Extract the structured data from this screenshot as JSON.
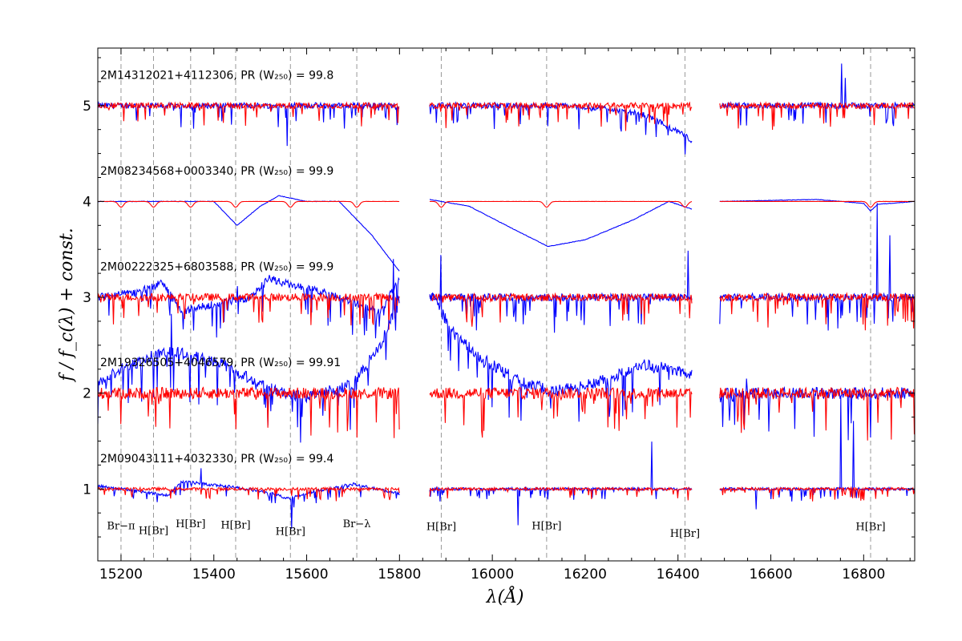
{
  "chart_data": {
    "type": "line",
    "xlabel": "λ(Å)",
    "ylabel": "f / f_c(λ) + const.",
    "xlim": [
      15150,
      16910
    ],
    "ylim": [
      0.25,
      5.6
    ],
    "x_ticks": [
      "15200",
      "15400",
      "15600",
      "15800",
      "16000",
      "16200",
      "16400",
      "16600",
      "16800"
    ],
    "y_ticks": [
      "1",
      "2",
      "3",
      "4",
      "5"
    ],
    "chips": [
      [
        15150,
        15800
      ],
      [
        15865,
        16430
      ],
      [
        16490,
        16910
      ]
    ],
    "grid": false,
    "legend": "none",
    "colors": {
      "observed": "#0000ff",
      "model": "#ff0000",
      "marker": "#999999"
    },
    "line_markers": [
      {
        "x": 15200,
        "label": "Br−π"
      },
      {
        "x": 15270,
        "label": "H[Br]"
      },
      {
        "x": 15350,
        "label": "H[Br]"
      },
      {
        "x": 15447,
        "label": "H[Br]"
      },
      {
        "x": 15565,
        "label": "H[Br]"
      },
      {
        "x": 15708,
        "label": "Br−λ"
      },
      {
        "x": 15890,
        "label": "H[Br]"
      },
      {
        "x": 16117,
        "label": "H[Br]"
      },
      {
        "x": 16415,
        "label": "H[Br]"
      },
      {
        "x": 16815,
        "label": "H[Br]"
      }
    ],
    "spectra": [
      {
        "label": "2M14312021+4112306, PR (W₂₅₀) = 99.8",
        "offset": 5.0,
        "continuum": [
          [
            15150,
            5.0
          ],
          [
            16150,
            5.0
          ],
          [
            16250,
            4.97
          ],
          [
            16330,
            4.9
          ],
          [
            16380,
            4.78
          ],
          [
            16430,
            4.64
          ],
          [
            16490,
            5.0
          ],
          [
            16910,
            5.0
          ]
        ],
        "observed_noise": 0.06,
        "model_noise": 0.06
      },
      {
        "label": "2M08234568+0003340, PR (W₂₅₀) = 99.9",
        "offset": 4.0,
        "continuum": [
          [
            15150,
            4.0
          ],
          [
            15400,
            4.0
          ],
          [
            15450,
            3.75
          ],
          [
            15500,
            3.95
          ],
          [
            15540,
            4.06
          ],
          [
            15600,
            4.0
          ],
          [
            15670,
            4.0
          ],
          [
            15740,
            3.65
          ],
          [
            15800,
            3.27
          ],
          [
            15865,
            4.02
          ],
          [
            15950,
            3.95
          ],
          [
            16050,
            3.7
          ],
          [
            16120,
            3.53
          ],
          [
            16200,
            3.6
          ],
          [
            16300,
            3.8
          ],
          [
            16380,
            4.0
          ],
          [
            16430,
            3.92
          ],
          [
            16490,
            4.0
          ],
          [
            16700,
            4.02
          ],
          [
            16800,
            3.98
          ],
          [
            16815,
            3.9
          ],
          [
            16830,
            3.97
          ],
          [
            16910,
            4.0
          ]
        ],
        "observed_noise": 0.005,
        "model_noise": 0.002
      },
      {
        "label": "2M00222325+6803588, PR (W₂₅₀) = 99.9",
        "offset": 3.0,
        "continuum": [
          [
            15150,
            3.0
          ],
          [
            15230,
            3.05
          ],
          [
            15290,
            3.15
          ],
          [
            15330,
            2.85
          ],
          [
            15420,
            2.95
          ],
          [
            15480,
            3.0
          ],
          [
            15520,
            3.2
          ],
          [
            15570,
            3.12
          ],
          [
            15640,
            3.05
          ],
          [
            15700,
            2.95
          ],
          [
            15760,
            2.85
          ],
          [
            15800,
            3.2
          ],
          [
            15865,
            3.0
          ],
          [
            16430,
            3.0
          ],
          [
            16490,
            3.0
          ],
          [
            16910,
            3.0
          ]
        ],
        "observed_noise": 0.08,
        "model_noise": 0.08
      },
      {
        "label": "2M19326505+4046579, PR (W₂₅₀) = 99.91",
        "offset": 2.0,
        "continuum": [
          [
            15150,
            2.1
          ],
          [
            15200,
            2.25
          ],
          [
            15300,
            2.45
          ],
          [
            15420,
            2.3
          ],
          [
            15520,
            2.05
          ],
          [
            15600,
            1.95
          ],
          [
            15700,
            2.1
          ],
          [
            15760,
            2.5
          ],
          [
            15800,
            3.0
          ],
          [
            15865,
            3.05
          ],
          [
            15920,
            2.6
          ],
          [
            15980,
            2.35
          ],
          [
            16050,
            2.15
          ],
          [
            16130,
            2.02
          ],
          [
            16220,
            2.1
          ],
          [
            16330,
            2.3
          ],
          [
            16430,
            2.2
          ],
          [
            16490,
            2.0
          ],
          [
            16910,
            2.0
          ]
        ],
        "observed_noise": 0.12,
        "model_noise": 0.12
      },
      {
        "label": "2M09043111+4032330, PR (W₂₅₀) = 99.4",
        "offset": 1.0,
        "continuum": [
          [
            15150,
            1.03
          ],
          [
            15250,
            0.97
          ],
          [
            15300,
            0.93
          ],
          [
            15330,
            1.08
          ],
          [
            15440,
            1.02
          ],
          [
            15520,
            0.96
          ],
          [
            15560,
            0.9
          ],
          [
            15620,
            0.98
          ],
          [
            15700,
            1.05
          ],
          [
            15800,
            0.95
          ],
          [
            15865,
            1.0
          ],
          [
            16430,
            1.0
          ],
          [
            16490,
            1.0
          ],
          [
            16910,
            1.0
          ]
        ],
        "observed_noise": 0.03,
        "model_noise": 0.03
      }
    ]
  }
}
